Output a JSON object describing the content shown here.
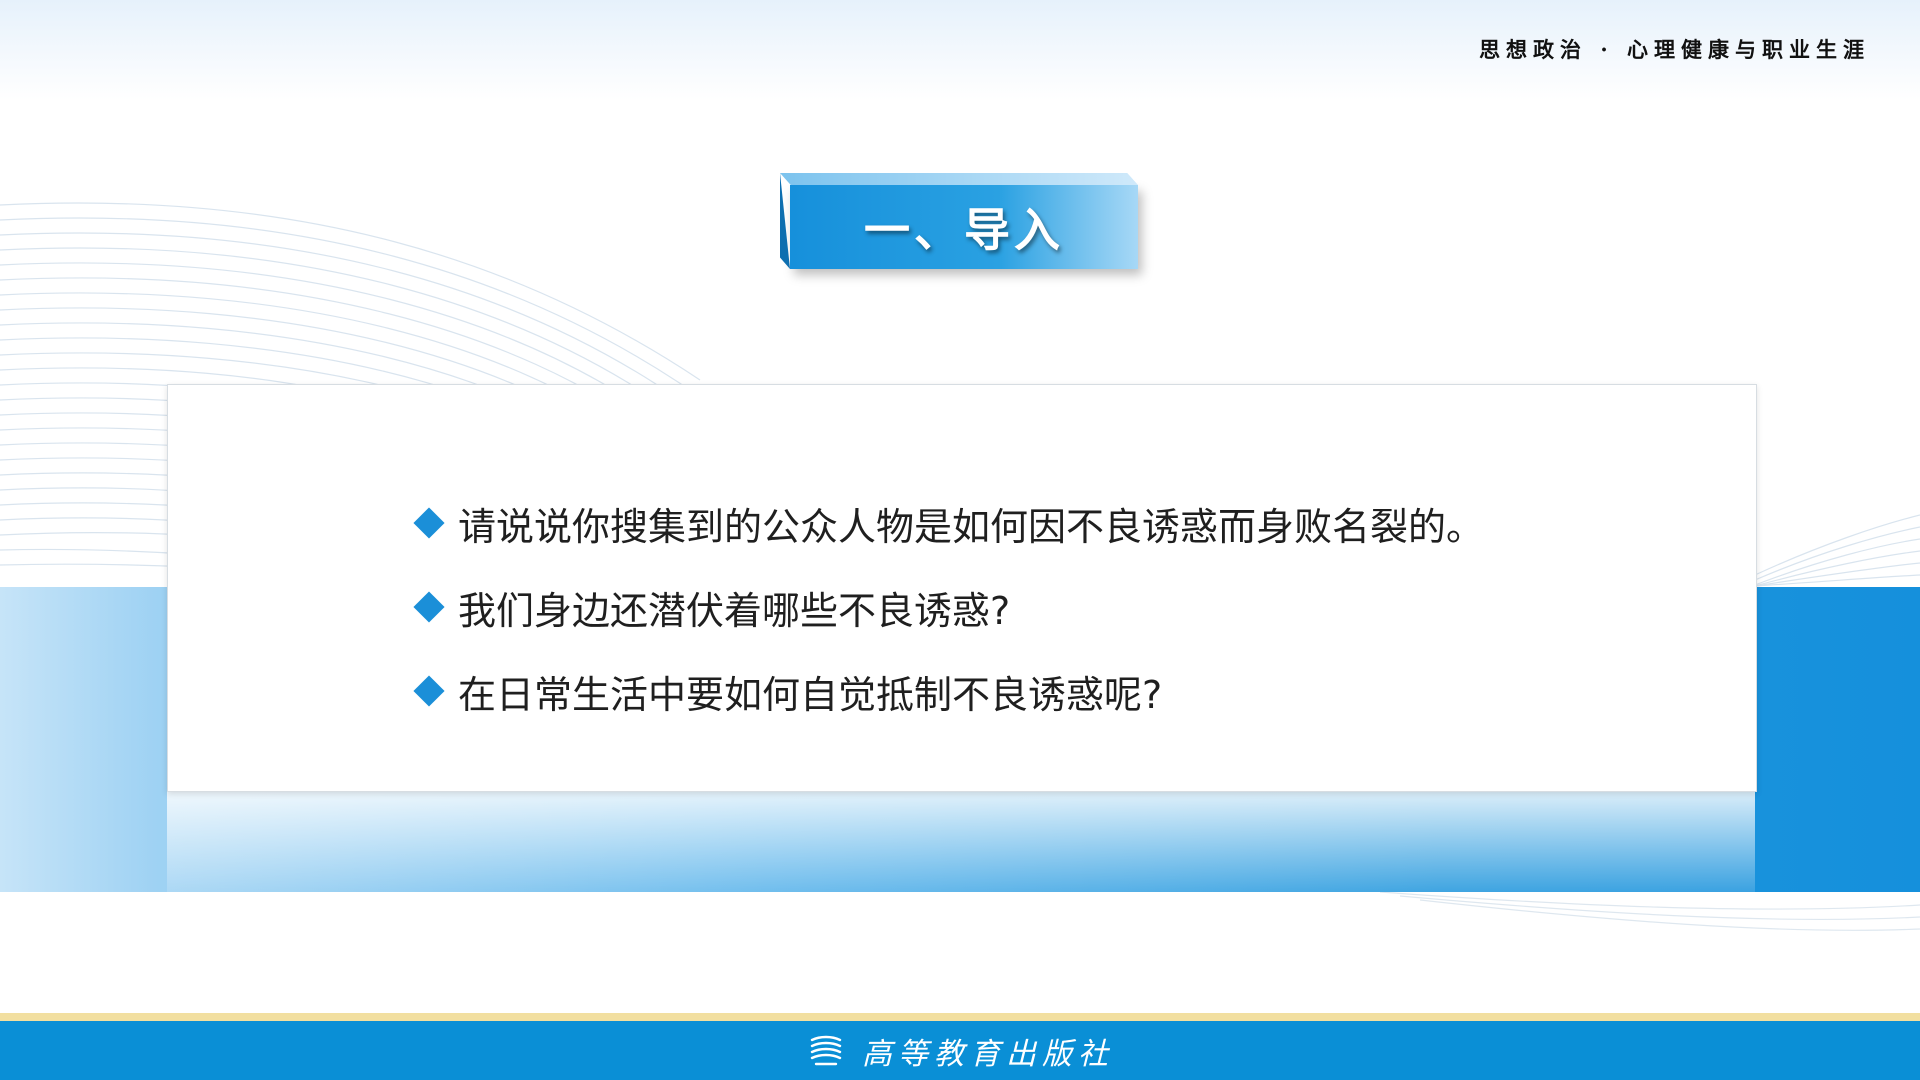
{
  "header": {
    "course_title": "思想政治 · 心理健康与职业生涯"
  },
  "section": {
    "title": "一、导入"
  },
  "questions": [
    "请说说你搜集到的公众人物是如何因不良诱惑而身败名裂的。",
    "我们身边还潜伏着哪些不良诱惑?",
    "在日常生活中要如何自觉抵制不良诱惑呢?"
  ],
  "footer": {
    "publisher": "高等教育出版社",
    "logo_icon": "book-stack-icon"
  },
  "colors": {
    "accent": "#1b8fd8",
    "footer_bar": "#0a8fd6",
    "footer_stripe": "#f2dfa0"
  }
}
